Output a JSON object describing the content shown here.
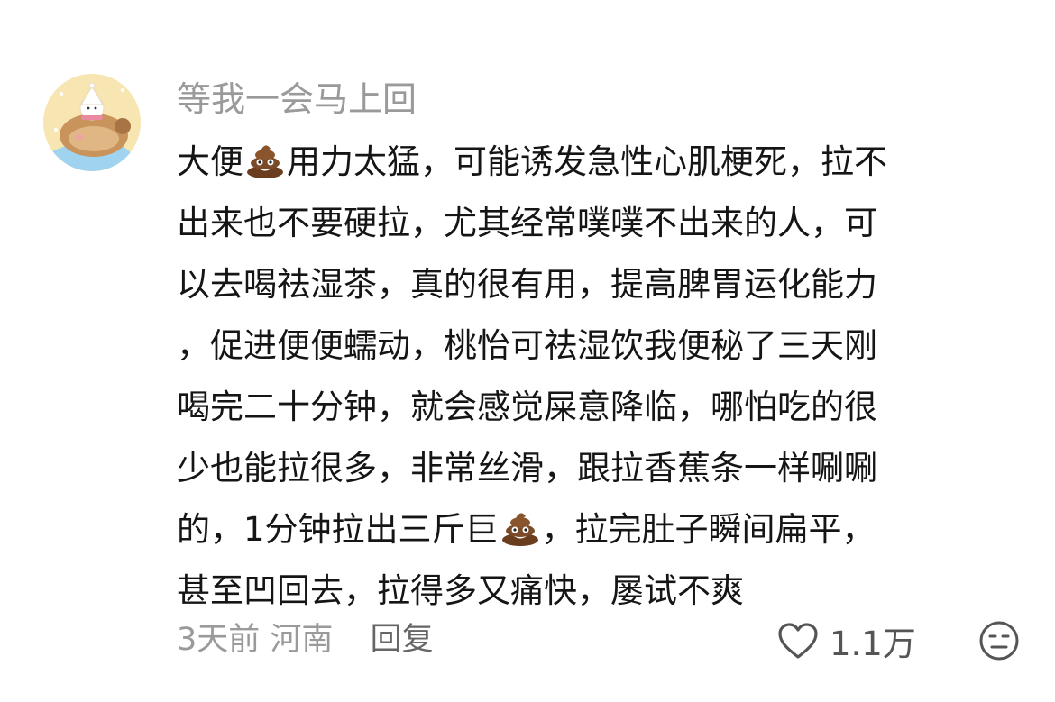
{
  "comment": {
    "username": "等我一会马上回",
    "content_lines": [
      [
        "大便",
        "poop-emoji",
        "用力太猛，可能诱发急性心肌梗死，拉不"
      ],
      [
        "出来也不要硬拉，尤其经常噗噗不出来的人，可"
      ],
      [
        "以去喝祛湿茶，真的很有用，提高脾胃运化能力"
      ],
      [
        "，促进便便蠕动，桃怡可祛湿饮我便秘了三天刚"
      ],
      [
        "喝完二十分钟，就会感觉屎意降临，哪怕吃的很"
      ],
      [
        "少也能拉很多，非常丝滑，跟拉香蕉条一样唰唰"
      ],
      [
        "的，1分钟拉出三斤巨",
        "poop-emoji",
        "，拉完肚子瞬间扁平，"
      ],
      [
        "甚至凹回去，拉得多又痛快，屡试不爽"
      ]
    ],
    "time": "3天前",
    "location": "河南",
    "reply_label": "回复",
    "like_count": "1.1万",
    "icons": {
      "like": "heart-outline-icon",
      "reaction": "neutral-face-icon",
      "emoji": "poop-emoji"
    }
  }
}
